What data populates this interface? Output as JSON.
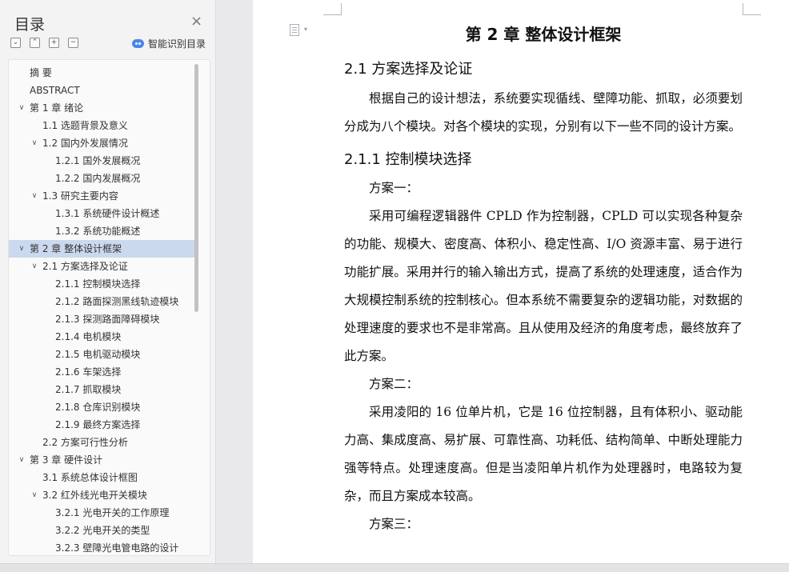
{
  "toc_panel": {
    "title": "目录",
    "controls": [
      {
        "name": "collapse-all-icon",
        "glyph": "⌄"
      },
      {
        "name": "expand-up-icon",
        "glyph": "⌃"
      },
      {
        "name": "add-heading-icon",
        "glyph": "+"
      },
      {
        "name": "remove-heading-icon",
        "glyph": "−"
      }
    ],
    "smart_toc_label": "智能识别目录",
    "items": [
      {
        "label": "摘    要",
        "level": 0,
        "expanded": null
      },
      {
        "label": "ABSTRACT",
        "level": 0,
        "expanded": null
      },
      {
        "label": "第 1 章  绪论",
        "level": 0,
        "expanded": true
      },
      {
        "label": "1.1 选题背景及意义",
        "level": 1,
        "expanded": null
      },
      {
        "label": "1.2  国内外发展情况",
        "level": 1,
        "expanded": true
      },
      {
        "label": "1.2.1 国外发展概况",
        "level": 2,
        "expanded": null
      },
      {
        "label": "1.2.2 国内发展概况",
        "level": 2,
        "expanded": null
      },
      {
        "label": "1.3 研究主要内容",
        "level": 1,
        "expanded": true
      },
      {
        "label": "1.3.1  系统硬件设计概述",
        "level": 2,
        "expanded": null
      },
      {
        "label": "1.3.2  系统功能概述",
        "level": 2,
        "expanded": null
      },
      {
        "label": "第 2 章  整体设计框架",
        "level": 0,
        "expanded": true,
        "selected": true
      },
      {
        "label": "2.1  方案选择及论证",
        "level": 1,
        "expanded": true
      },
      {
        "label": "2.1.1  控制模块选择",
        "level": 2,
        "expanded": null
      },
      {
        "label": "2.1.2  路面探测黑线轨迹模块",
        "level": 2,
        "expanded": null
      },
      {
        "label": "2.1.3  探测路面障碍模块",
        "level": 2,
        "expanded": null
      },
      {
        "label": "2.1.4  电机模块",
        "level": 2,
        "expanded": null
      },
      {
        "label": "2.1.5  电机驱动模块",
        "level": 2,
        "expanded": null
      },
      {
        "label": "2.1.6  车架选择",
        "level": 2,
        "expanded": null
      },
      {
        "label": "2.1.7  抓取模块",
        "level": 2,
        "expanded": null
      },
      {
        "label": "2.1.8  仓库识别模块",
        "level": 2,
        "expanded": null
      },
      {
        "label": "2.1.9  最终方案选择",
        "level": 2,
        "expanded": null
      },
      {
        "label": "2.2  方案可行性分析",
        "level": 1,
        "expanded": null
      },
      {
        "label": "第 3 章  硬件设计",
        "level": 0,
        "expanded": true
      },
      {
        "label": "3.1  系统总体设计框图",
        "level": 1,
        "expanded": null
      },
      {
        "label": "3.2  红外线光电开关模块",
        "level": 1,
        "expanded": true
      },
      {
        "label": "3.2.1  光电开关的工作原理",
        "level": 2,
        "expanded": null
      },
      {
        "label": "3.2.2  光电开关的类型",
        "level": 2,
        "expanded": null
      },
      {
        "label": "3.2.3  壁障光电管电路的设计",
        "level": 2,
        "expanded": null
      }
    ]
  },
  "document": {
    "chapter_title": "第 2 章  整体设计框架",
    "section_2_1": "2.1  方案选择及论证",
    "para_intro": "根据自己的设计想法，系统要实现循线、壁障功能、抓取，必须要划分成为八个模块。对各个模块的实现，分别有以下一些不同的设计方案。",
    "section_2_1_1": "2.1.1  控制模块选择",
    "scheme1_label": "方案一：",
    "scheme1_text": "采用可编程逻辑器件 CPLD 作为控制器，CPLD 可以实现各种复杂的功能、规模大、密度高、体积小、稳定性高、I/O 资源丰富、易于进行功能扩展。采用并行的输入输出方式，提高了系统的处理速度，适合作为大规模控制系统的控制核心。但本系统不需要复杂的逻辑功能，对数据的处理速度的要求也不是非常高。且从使用及经济的角度考虑，最终放弃了此方案。",
    "scheme2_label": "方案二：",
    "scheme2_text": "采用凌阳的 16 位单片机，它是 16 位控制器，且有体积小、驱动能力高、集成度高、易扩展、可靠性高、功耗低、结构简单、中断处理能力强等特点。处理速度高。但是当凌阳单片机作为处理器时，电路较为复杂，而且方案成本较高。",
    "scheme3_label": "方案三："
  }
}
